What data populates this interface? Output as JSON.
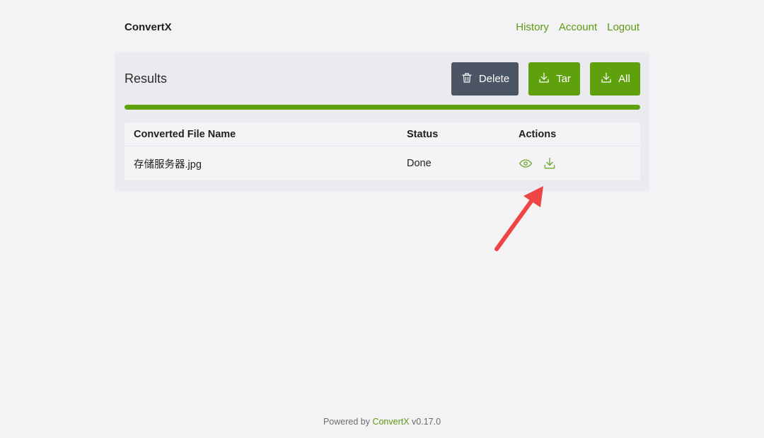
{
  "navbar": {
    "brand": "ConvertX",
    "links": [
      "History",
      "Account",
      "Logout"
    ]
  },
  "results": {
    "title": "Results",
    "buttons": {
      "delete": "Delete",
      "tar": "Tar",
      "all": "All"
    },
    "progress_percent": 100,
    "table": {
      "headers": [
        "Converted File Name",
        "Status",
        "Actions"
      ],
      "rows": [
        {
          "file_name": "存储服务器.jpg",
          "status": "Done",
          "actions": [
            "eye-icon",
            "download-icon"
          ]
        }
      ]
    }
  },
  "footer": {
    "prefix": "Powered by",
    "link": "ConvertX",
    "version": "v0.17.0"
  },
  "colors": {
    "accent": "#5fa00d",
    "delete_button": "#4b5563",
    "background": "#f3f3f6",
    "annotation_arrow": "#ef4444"
  }
}
